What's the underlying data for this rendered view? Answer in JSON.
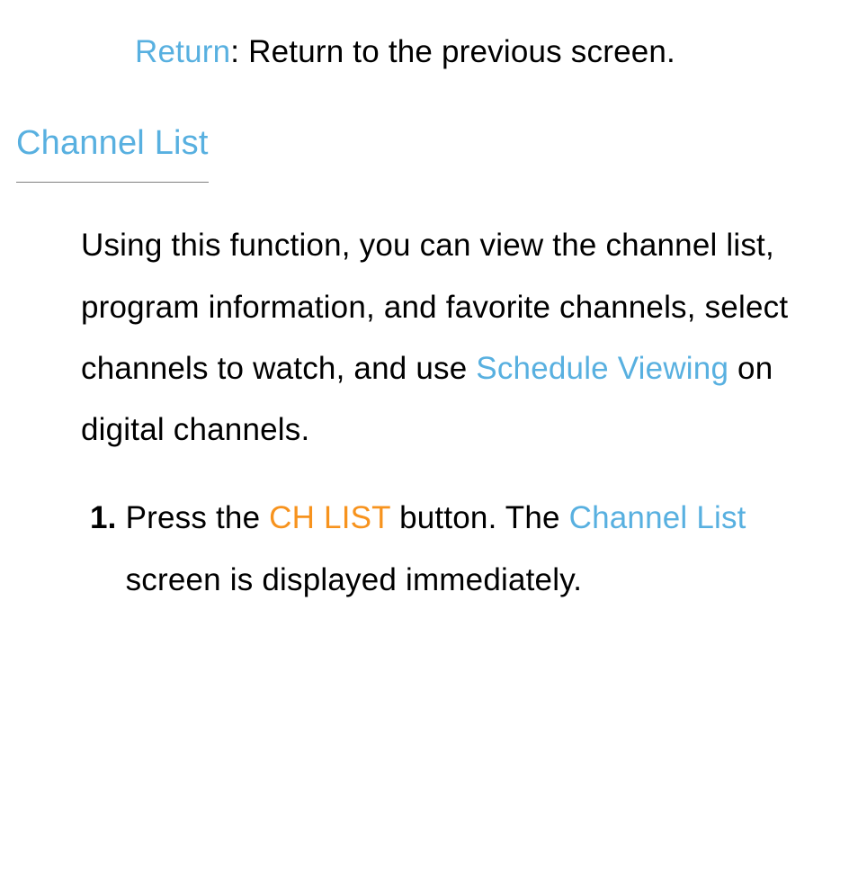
{
  "colors": {
    "link": "#58b0e0",
    "accent": "#f7931e",
    "text": "#000000",
    "bg": "#ffffff"
  },
  "bullet": {
    "return_label": "Return",
    "return_colon": ": ",
    "return_desc": "Return to the previous screen."
  },
  "heading": "Channel List",
  "intro": {
    "pre": "Using this function, you can view the channel list, program information, and favorite channels, select channels to watch, and use ",
    "schedule_viewing": "Schedule Viewing",
    "post": " on digital channels."
  },
  "step1": {
    "num": "1.",
    "t1": "Press the ",
    "chlist": "CH LIST",
    "t2": " button. The ",
    "channel_list": "Channel List",
    "t3": " screen is displayed immediately."
  }
}
